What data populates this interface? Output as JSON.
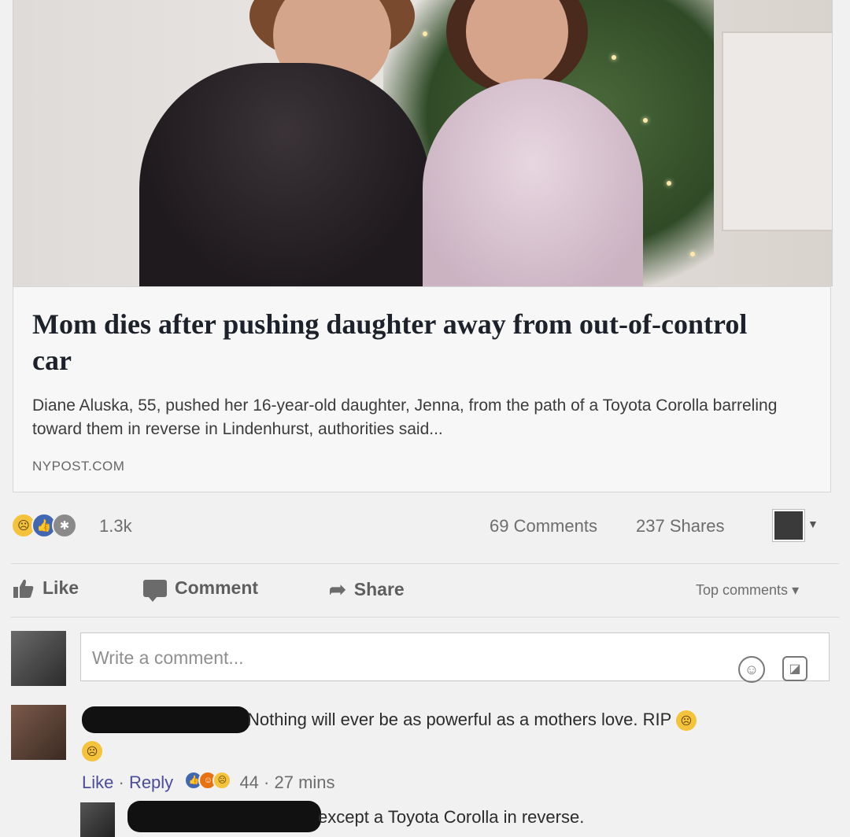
{
  "link_card": {
    "headline": "Mom dies after pushing daughter away from out-of-control car",
    "description": "Diane Aluska, 55, pushed her 16-year-old daughter, Jenna, from the path of a Toyota Corolla barreling toward them in reverse in Lindenhurst, authorities said...",
    "source": "NYPOST.COM"
  },
  "stats": {
    "reactions": [
      "sad-reaction",
      "like-reaction",
      "wow-reaction"
    ],
    "reaction_count": "1.3k",
    "comments": "69 Comments",
    "shares": "237 Shares"
  },
  "actions": {
    "like": "Like",
    "comment": "Comment",
    "share": "Share",
    "sort": "Top comments"
  },
  "composer": {
    "placeholder": "Write a comment..."
  },
  "comments": [
    {
      "text": "Nothing will ever be as powerful as a mothers love. RIP",
      "like": "Like",
      "reply": "Reply",
      "reaction_count": "44",
      "time": "27 mins"
    },
    {
      "text": "except a Toyota Corolla in reverse."
    }
  ],
  "colors": {
    "facebook_blue": "#4267b2",
    "sad_yellow": "#f5c33b",
    "muted_text": "#6d6d6d"
  }
}
